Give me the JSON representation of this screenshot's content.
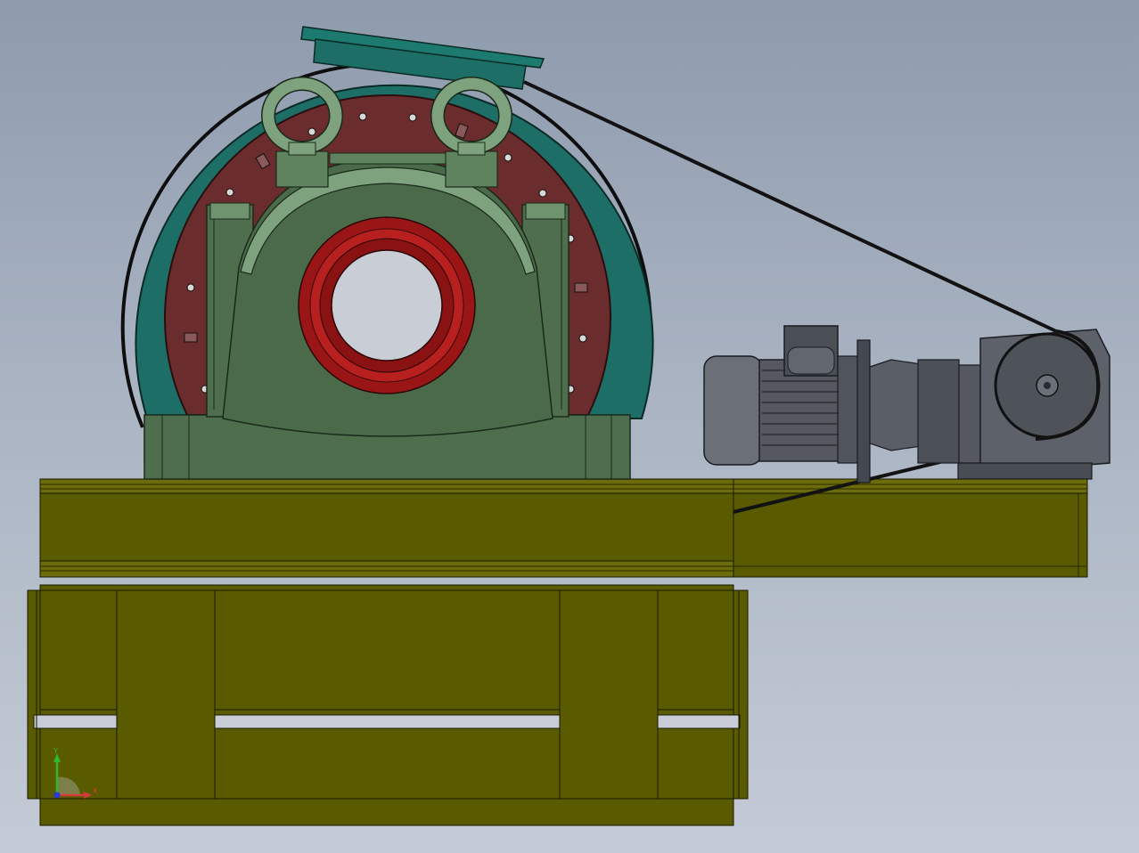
{
  "triad": {
    "y_label": "Y",
    "x_label": "X",
    "y_color": "#2fb52f",
    "x_color": "#d43c3c",
    "origin_color": "#2a3ad8"
  },
  "colors": {
    "frame_olive": "#5a5a00",
    "frame_olive_light": "#7a7a14",
    "housing_teal": "#1c6e66",
    "pedestal_green": "#4a6a4a",
    "pedestal_light": "#6f926f",
    "liner_brown": "#6a2c2c",
    "bearing_red": "#a01818",
    "motor_gray": "#5c616a",
    "belt_black": "#121212"
  }
}
